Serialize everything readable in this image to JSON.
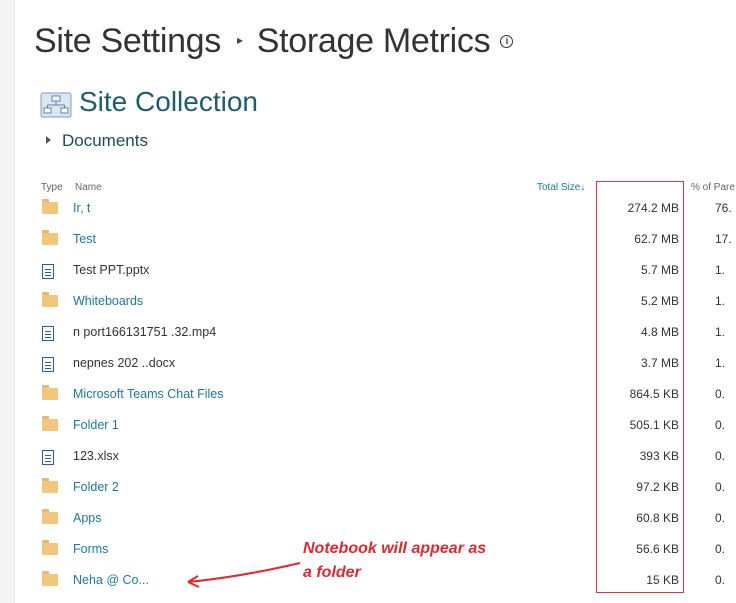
{
  "page": {
    "title": "Site Settings",
    "separator": "▸",
    "subtitle": "Storage Metrics",
    "info_icon": "info-icon",
    "info_glyph": "i"
  },
  "site_collection": {
    "icon": "site-collection-icon",
    "label": "Site Collection"
  },
  "breadcrumb": {
    "icon": "caret-right-icon",
    "label": "Documents"
  },
  "table": {
    "headers": {
      "type": "Type",
      "name": "Name",
      "total_size": "Total Size↓",
      "percent_parent": "% of Pare"
    },
    "rows": [
      {
        "type": "folder",
        "name": "Ir‚ t",
        "size": "274.2 MB",
        "percent": "76.",
        "link": true
      },
      {
        "type": "folder",
        "name": "Test",
        "size": "62.7 MB",
        "percent": "17.",
        "link": true
      },
      {
        "type": "file",
        "name": "Test PPT.pptx",
        "size": "5.7 MB",
        "percent": "1.",
        "link": false
      },
      {
        "type": "folder",
        "name": "Whiteboards",
        "size": "5.2 MB",
        "percent": "1.",
        "link": true
      },
      {
        "type": "file",
        "name": "n port166131751 .32.mp4",
        "size": "4.8 MB",
        "percent": "1.",
        "link": false
      },
      {
        "type": "file",
        "name": "nepnes 202 ..docx",
        "size": "3.7 MB",
        "percent": "1.",
        "link": false
      },
      {
        "type": "folder",
        "name": "Microsoft Teams Chat Files",
        "size": "864.5 KB",
        "percent": "0.",
        "link": true
      },
      {
        "type": "folder",
        "name": "Folder 1",
        "size": "505.1 KB",
        "percent": "0.",
        "link": true
      },
      {
        "type": "file",
        "name": "123.xlsx",
        "size": "393 KB",
        "percent": "0.",
        "link": false
      },
      {
        "type": "folder",
        "name": "Folder 2",
        "size": "97.2 KB",
        "percent": "0.",
        "link": true
      },
      {
        "type": "folder",
        "name": "Apps",
        "size": "60.8 KB",
        "percent": "0.",
        "link": true
      },
      {
        "type": "folder",
        "name": "Forms",
        "size": "56.6 KB",
        "percent": "0.",
        "link": true
      },
      {
        "type": "folder",
        "name": "Neha @ Co...",
        "size": "15 KB",
        "percent": "0.",
        "link": true
      }
    ]
  },
  "annotation": {
    "line1": "Notebook will appear as",
    "line2": "a folder",
    "color": "#e0282e"
  }
}
